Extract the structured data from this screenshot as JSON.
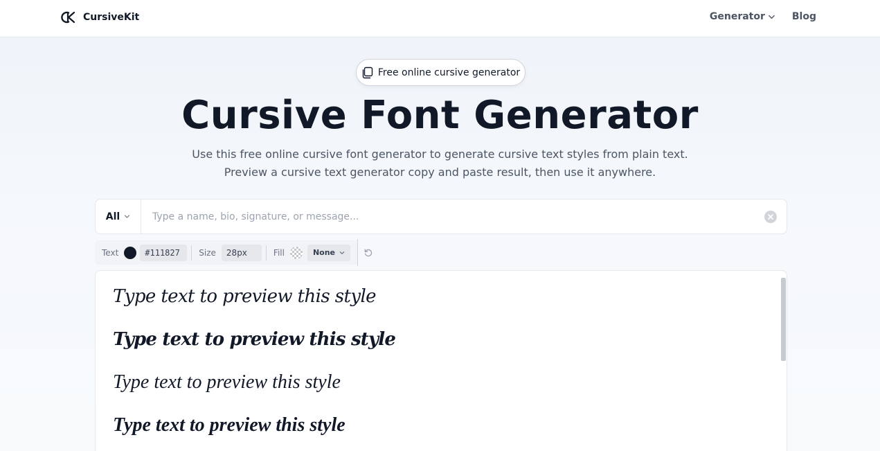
{
  "header": {
    "brand_name": "CursiveKit",
    "nav": [
      {
        "label": "Generator",
        "has_dropdown": true
      },
      {
        "label": "Blog"
      }
    ]
  },
  "hero": {
    "badge": "Free online cursive generator",
    "title": "Cursive Font Generator",
    "subtitle_line1": "Use this free online cursive font generator to generate cursive text styles from plain text.",
    "subtitle_line2": "Preview a cursive text generator copy and paste result, then use it anywhere."
  },
  "search": {
    "filter_label": "All",
    "placeholder": "Type a name, bio, signature, or message...",
    "value": ""
  },
  "toolbar": {
    "text_label": "Text",
    "text_color": "#111827",
    "size_label": "Size",
    "size_value": "28px",
    "fill_label": "Fill",
    "fill_value": "None"
  },
  "previews": [
    {
      "text": "Type text to preview this style"
    },
    {
      "text": "Type text to preview this style"
    },
    {
      "text": "Type text to preview this style"
    },
    {
      "text": "Type text to preview this style"
    }
  ],
  "colors": {
    "text_primary": "#111827",
    "text_muted": "#4b5563",
    "border": "#e5e7eb",
    "toolbar_bg": "#f1f3f6"
  }
}
